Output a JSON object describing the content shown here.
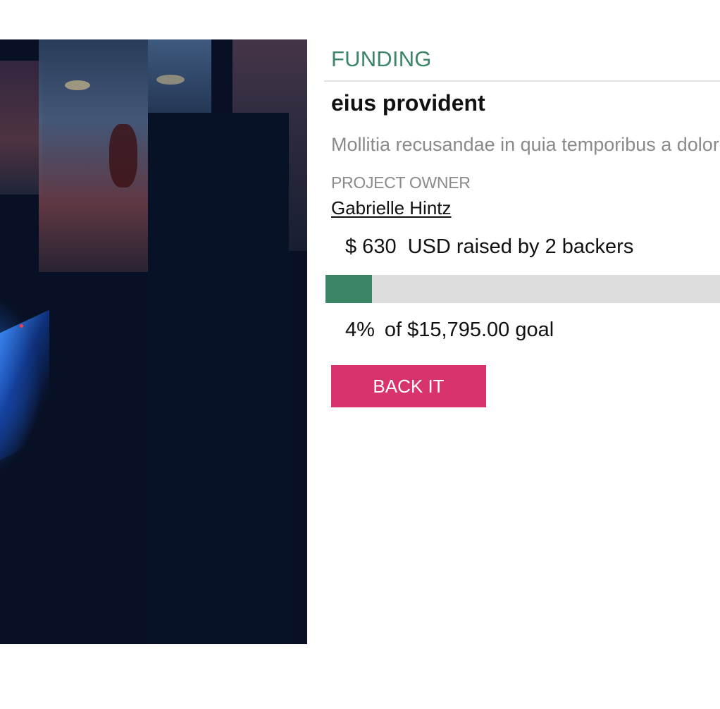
{
  "hero_image": {
    "alt_icon": "project-photo"
  },
  "funding": {
    "heading": "FUNDING",
    "project_title": "eius provident",
    "blurb": "Mollitia recusandae in quia temporibus a dolorem",
    "owner_label": "PROJECT OWNER",
    "owner_name": "Gabrielle Hintz",
    "raised_amount": "$ 630",
    "raised_suffix": "USD raised by 2 backers",
    "progress_fraction": 0.04,
    "percent_text": "4%",
    "goal_text": "of $15,795.00 goal",
    "back_button_label": "BACK IT"
  },
  "colors": {
    "accent_green": "#3c8566",
    "button_pink": "#d9336f",
    "track_gray": "#dcdcdc"
  }
}
